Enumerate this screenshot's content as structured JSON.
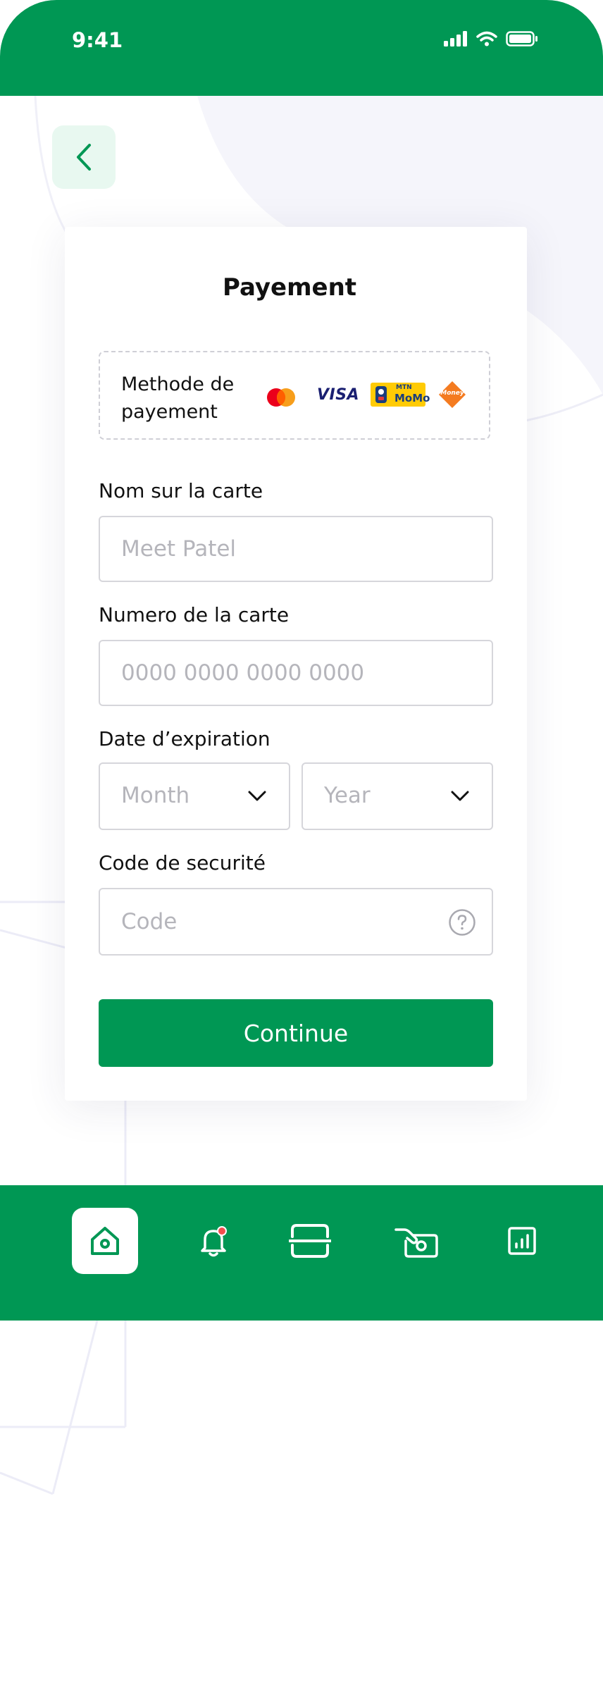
{
  "status_bar": {
    "time": "9:41",
    "icons": [
      "signal-icon",
      "wifi-icon",
      "battery-icon"
    ]
  },
  "header": {
    "back_icon": "chevron-left-icon"
  },
  "form": {
    "title": "Payement",
    "payment_method": {
      "label": "Methode de payement",
      "options": [
        {
          "name": "mastercard",
          "icon": "mastercard-logo"
        },
        {
          "name": "visa",
          "text": "VISA"
        },
        {
          "name": "mtn-momo",
          "text_top": "MTN",
          "text_bottom": "MoMo"
        },
        {
          "name": "moov-money",
          "text": "Money"
        }
      ]
    },
    "card_name": {
      "label": "Nom sur la carte",
      "placeholder": "Meet Patel"
    },
    "card_number": {
      "label": "Numero de la carte",
      "placeholder": "0000 0000 0000 0000"
    },
    "expiry": {
      "label": "Date d’expiration",
      "month_placeholder": "Month",
      "year_placeholder": "Year"
    },
    "security_code": {
      "label": "Code de securité",
      "placeholder": "Code",
      "help_icon": "question-circle-icon"
    },
    "submit_label": "Continue"
  },
  "bottom_nav": {
    "items": [
      {
        "name": "home",
        "icon": "home-icon",
        "active": true
      },
      {
        "name": "notifications",
        "icon": "bell-icon",
        "badge": true
      },
      {
        "name": "scan",
        "icon": "scan-icon"
      },
      {
        "name": "payments",
        "icon": "money-hand-icon"
      },
      {
        "name": "stats",
        "icon": "chart-icon"
      }
    ]
  },
  "colors": {
    "primary": "#009754",
    "primary_light": "#e8f8f0",
    "badge": "#f24e4e",
    "border": "#d6d6db",
    "placeholder": "#b5b5bb"
  }
}
